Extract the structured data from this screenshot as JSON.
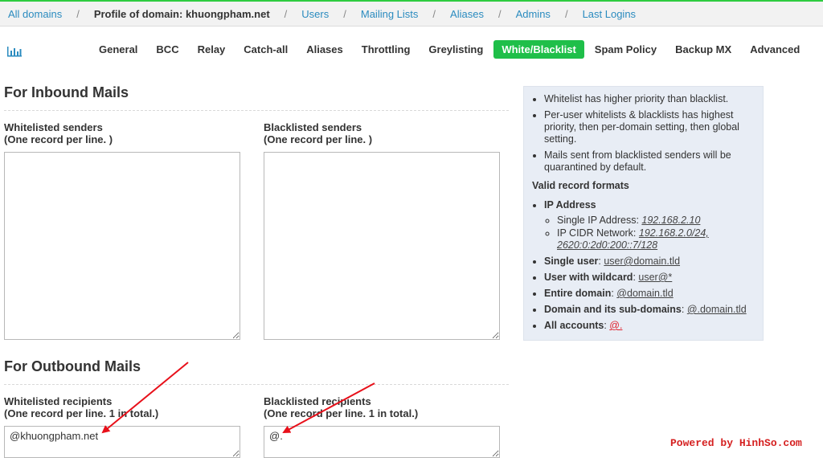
{
  "breadcrumb": {
    "all_domains": "All domains",
    "profile": "Profile of domain: khuongpham.net",
    "users": "Users",
    "mailing_lists": "Mailing Lists",
    "aliases": "Aliases",
    "admins": "Admins",
    "last_logins": "Last Logins"
  },
  "tabs": [
    "General",
    "BCC",
    "Relay",
    "Catch-all",
    "Aliases",
    "Throttling",
    "Greylisting",
    "White/Blacklist",
    "Spam Policy",
    "Backup MX",
    "Advanced"
  ],
  "active_tab": "White/Blacklist",
  "inbound": {
    "title": "For Inbound Mails",
    "whitelist_label_1": "Whitelisted senders",
    "whitelist_label_2": "(One record per line. )",
    "whitelist_value": "",
    "blacklist_label_1": "Blacklisted senders",
    "blacklist_label_2": "(One record per line. )",
    "blacklist_value": ""
  },
  "outbound": {
    "title": "For Outbound Mails",
    "whitelist_label_1": "Whitelisted recipients",
    "whitelist_label_2": "(One record per line. 1 in total.)",
    "whitelist_value": "@khuongpham.net",
    "blacklist_label_1": "Blacklisted recipients",
    "blacklist_label_2": "(One record per line. 1 in total.)",
    "blacklist_value": "@."
  },
  "info": {
    "notes": [
      "Whitelist has higher priority than blacklist.",
      "Per-user whitelists & blacklists has highest priority, then per-domain setting, then global setting.",
      "Mails sent from blacklisted senders will be quarantined by default."
    ],
    "heading": "Valid record formats",
    "ip_title": "IP Address",
    "single_ip_label": "Single IP Address:",
    "single_ip_value": "192.168.2.10",
    "cidr_label": "IP CIDR Network:",
    "cidr_value": "192.168.2.0/24, 2620:0:2d0:200::7/128",
    "single_user_label": "Single user",
    "single_user_value": "user@domain.tld",
    "wildcard_label": "User with wildcard",
    "wildcard_value": "user@*",
    "entire_domain_label": "Entire domain",
    "entire_domain_value": "@domain.tld",
    "subdomains_label": "Domain and its sub-domains",
    "subdomains_value": "@.domain.tld",
    "all_accounts_label": "All accounts",
    "all_accounts_value": "@."
  },
  "watermark": "Powered by HinhSo.com",
  "colors": {
    "accent": "#1fbf49",
    "link": "#2a8bbf",
    "arrow": "#e8101a",
    "watermark": "#d52020"
  }
}
